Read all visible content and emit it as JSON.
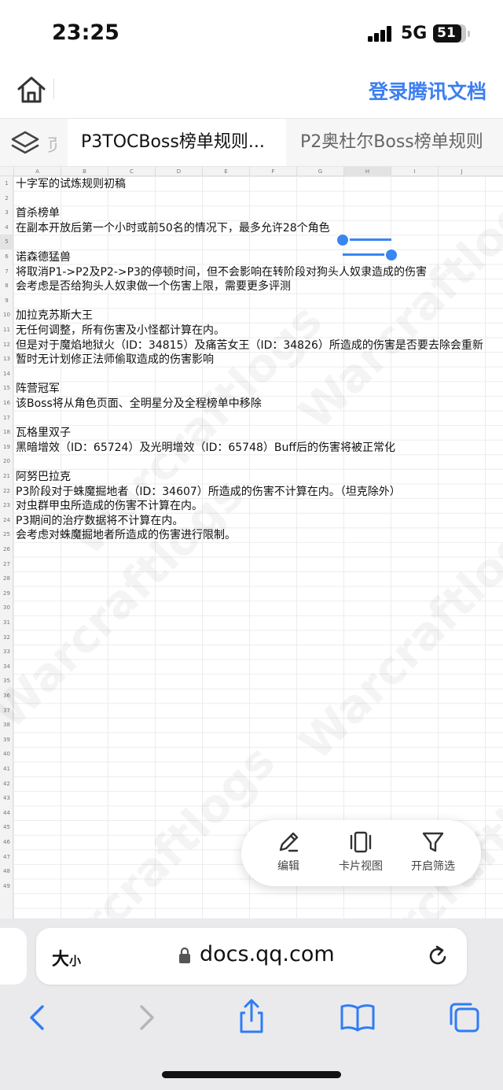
{
  "status": {
    "time": "23:25",
    "network": "5G",
    "battery": "51"
  },
  "header": {
    "login_label": "登录腾讯文档"
  },
  "tabs": {
    "partial_label": "页",
    "active_label": "P3TOCBoss榜单规则...",
    "inactive_label": "P2奥杜尔Boss榜单规则"
  },
  "sheet": {
    "columns": [
      "A",
      "B",
      "C",
      "D",
      "E",
      "F",
      "G",
      "H",
      "I",
      "J"
    ],
    "selected_column": "H",
    "selected_row": 5,
    "rows": [
      {
        "n": "1",
        "text": "十字军的试炼规则初稿"
      },
      {
        "n": "2",
        "text": ""
      },
      {
        "n": "3",
        "text": "首杀榜单"
      },
      {
        "n": "4",
        "text": "在副本开放后第一个小时或前50名的情况下，最多允许28个角色"
      },
      {
        "n": "5",
        "text": ""
      },
      {
        "n": "6",
        "text": "诺森德猛兽"
      },
      {
        "n": "7",
        "text": "将取消P1->P2及P2->P3的停顿时间，但不会影响在转阶段对狗头人奴隶造成的伤害"
      },
      {
        "n": "8",
        "text": "会考虑是否给狗头人奴隶做一个伤害上限，需要更多评测"
      },
      {
        "n": "9",
        "text": ""
      },
      {
        "n": "10",
        "text": "加拉克苏斯大王"
      },
      {
        "n": "11",
        "text": "无任何调整，所有伤害及小怪都计算在内。"
      },
      {
        "n": "12",
        "text": "但是对于魔焰地狱火（ID：34815）及痛苦女王（ID：34826）所造成的伤害是否要去除会重新"
      },
      {
        "n": "13",
        "text": "暂时无计划修正法师偷取造成的伤害影响"
      },
      {
        "n": "14",
        "text": ""
      },
      {
        "n": "15",
        "text": "阵营冠军"
      },
      {
        "n": "16",
        "text": "该Boss将从角色页面、全明星分及全程榜单中移除"
      },
      {
        "n": "17",
        "text": ""
      },
      {
        "n": "18",
        "text": "瓦格里双子"
      },
      {
        "n": "19",
        "text": "黑暗增效（ID：65724）及光明增效（ID：65748）Buff后的伤害将被正常化"
      },
      {
        "n": "20",
        "text": ""
      },
      {
        "n": "21",
        "text": "阿努巴拉克"
      },
      {
        "n": "22",
        "text": "P3阶段对于蛛魔掘地者（ID：34607）所造成的伤害不计算在内。（坦克除外）"
      },
      {
        "n": "23",
        "text": "对虫群甲虫所造成的伤害不计算在内。"
      },
      {
        "n": "24",
        "text": "P3期间的治疗数据将不计算在内。"
      },
      {
        "n": "25",
        "text": "会考虑对蛛魔掘地者所造成的伤害进行限制。"
      },
      {
        "n": "26",
        "text": ""
      },
      {
        "n": "27",
        "text": ""
      },
      {
        "n": "28",
        "text": ""
      },
      {
        "n": "29",
        "text": ""
      },
      {
        "n": "30",
        "text": ""
      },
      {
        "n": "31",
        "text": ""
      },
      {
        "n": "32",
        "text": ""
      },
      {
        "n": "33",
        "text": ""
      },
      {
        "n": "34",
        "text": ""
      },
      {
        "n": "35",
        "text": ""
      },
      {
        "n": "36",
        "text": ""
      },
      {
        "n": "37",
        "text": ""
      },
      {
        "n": "38",
        "text": ""
      },
      {
        "n": "39",
        "text": ""
      },
      {
        "n": "40",
        "text": ""
      },
      {
        "n": "41",
        "text": ""
      },
      {
        "n": "42",
        "text": ""
      },
      {
        "n": "43",
        "text": ""
      },
      {
        "n": "44",
        "text": ""
      },
      {
        "n": "45",
        "text": ""
      },
      {
        "n": "46",
        "text": ""
      },
      {
        "n": "47",
        "text": ""
      },
      {
        "n": "48",
        "text": ""
      },
      {
        "n": "49",
        "text": ""
      }
    ],
    "watermark": "Warcraftlogs"
  },
  "toolbar": {
    "edit_label": "编辑",
    "card_label": "卡片视图",
    "filter_label": "开启筛选"
  },
  "browser": {
    "text_size_big": "大",
    "text_size_small": "小",
    "url": "docs.qq.com"
  }
}
